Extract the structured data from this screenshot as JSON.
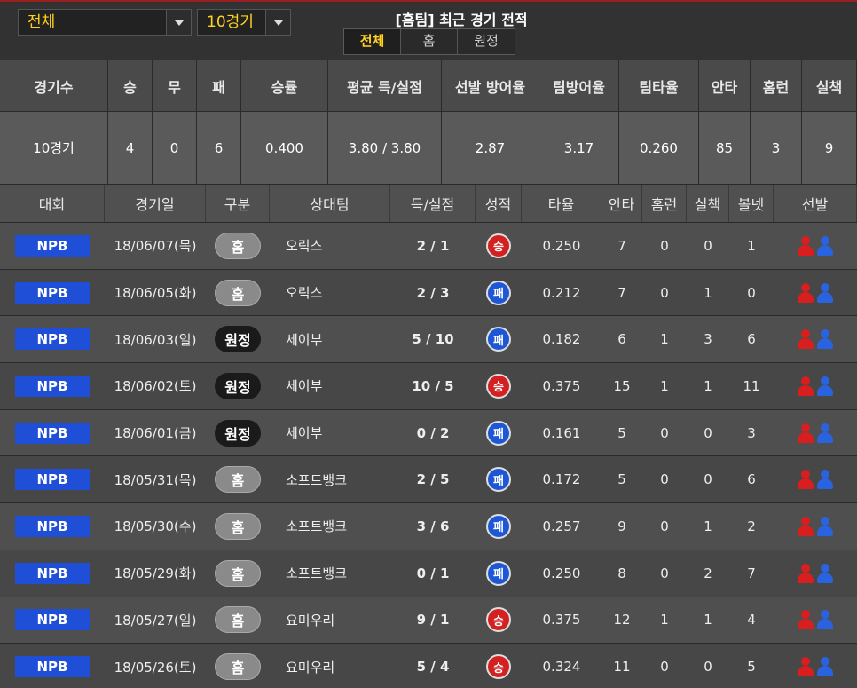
{
  "filters": {
    "scope_value": "전체",
    "count_value": "10경기"
  },
  "header": {
    "title": "[홈팀] 최근 경기 전적",
    "tabs": [
      {
        "label": "전체",
        "active": true
      },
      {
        "label": "홈",
        "active": false
      },
      {
        "label": "원정",
        "active": false
      }
    ]
  },
  "summary": {
    "columns": [
      "경기수",
      "승",
      "무",
      "패",
      "승률",
      "평균 득/실점",
      "선발 방어율",
      "팀방어율",
      "팀타율",
      "안타",
      "홈런",
      "실책"
    ],
    "values": [
      "10경기",
      "4",
      "0",
      "6",
      "0.400",
      "3.80 / 3.80",
      "2.87",
      "3.17",
      "0.260",
      "85",
      "3",
      "9"
    ]
  },
  "games": {
    "columns": [
      "대회",
      "경기일",
      "구분",
      "상대팀",
      "득/실점",
      "성적",
      "타율",
      "안타",
      "홈런",
      "실책",
      "볼넷",
      "선발"
    ],
    "rows": [
      {
        "league": "NPB",
        "date": "18/06/07(목)",
        "venue": "홈",
        "venue_type": "home",
        "opponent": "오릭스",
        "score": "2 / 1",
        "result": "승",
        "result_type": "win",
        "avg": "0.250",
        "hits": "7",
        "hr": "0",
        "errors": "0",
        "walks": "1"
      },
      {
        "league": "NPB",
        "date": "18/06/05(화)",
        "venue": "홈",
        "venue_type": "home",
        "opponent": "오릭스",
        "score": "2 / 3",
        "result": "패",
        "result_type": "loss",
        "avg": "0.212",
        "hits": "7",
        "hr": "0",
        "errors": "1",
        "walks": "0"
      },
      {
        "league": "NPB",
        "date": "18/06/03(일)",
        "venue": "원정",
        "venue_type": "away",
        "opponent": "세이부",
        "score": "5 / 10",
        "result": "패",
        "result_type": "loss",
        "avg": "0.182",
        "hits": "6",
        "hr": "1",
        "errors": "3",
        "walks": "6"
      },
      {
        "league": "NPB",
        "date": "18/06/02(토)",
        "venue": "원정",
        "venue_type": "away",
        "opponent": "세이부",
        "score": "10 / 5",
        "result": "승",
        "result_type": "win",
        "avg": "0.375",
        "hits": "15",
        "hr": "1",
        "errors": "1",
        "walks": "11"
      },
      {
        "league": "NPB",
        "date": "18/06/01(금)",
        "venue": "원정",
        "venue_type": "away",
        "opponent": "세이부",
        "score": "0 / 2",
        "result": "패",
        "result_type": "loss",
        "avg": "0.161",
        "hits": "5",
        "hr": "0",
        "errors": "0",
        "walks": "3"
      },
      {
        "league": "NPB",
        "date": "18/05/31(목)",
        "venue": "홈",
        "venue_type": "home",
        "opponent": "소프트뱅크",
        "score": "2 / 5",
        "result": "패",
        "result_type": "loss",
        "avg": "0.172",
        "hits": "5",
        "hr": "0",
        "errors": "0",
        "walks": "6"
      },
      {
        "league": "NPB",
        "date": "18/05/30(수)",
        "venue": "홈",
        "venue_type": "home",
        "opponent": "소프트뱅크",
        "score": "3 / 6",
        "result": "패",
        "result_type": "loss",
        "avg": "0.257",
        "hits": "9",
        "hr": "0",
        "errors": "1",
        "walks": "2"
      },
      {
        "league": "NPB",
        "date": "18/05/29(화)",
        "venue": "홈",
        "venue_type": "home",
        "opponent": "소프트뱅크",
        "score": "0 / 1",
        "result": "패",
        "result_type": "loss",
        "avg": "0.250",
        "hits": "8",
        "hr": "0",
        "errors": "2",
        "walks": "7"
      },
      {
        "league": "NPB",
        "date": "18/05/27(일)",
        "venue": "홈",
        "venue_type": "home",
        "opponent": "요미우리",
        "score": "9 / 1",
        "result": "승",
        "result_type": "win",
        "avg": "0.375",
        "hits": "12",
        "hr": "1",
        "errors": "1",
        "walks": "4"
      },
      {
        "league": "NPB",
        "date": "18/05/26(토)",
        "venue": "홈",
        "venue_type": "home",
        "opponent": "요미우리",
        "score": "5 / 4",
        "result": "승",
        "result_type": "win",
        "avg": "0.324",
        "hits": "11",
        "hr": "0",
        "errors": "0",
        "walks": "5"
      }
    ]
  },
  "colors": {
    "accent": "#ffd21f",
    "league_badge": "#1f4fd6",
    "win": "#d32020",
    "loss": "#1d57d6"
  },
  "icons": {
    "starter_home": "person-red-icon",
    "starter_away": "person-blue-icon"
  }
}
